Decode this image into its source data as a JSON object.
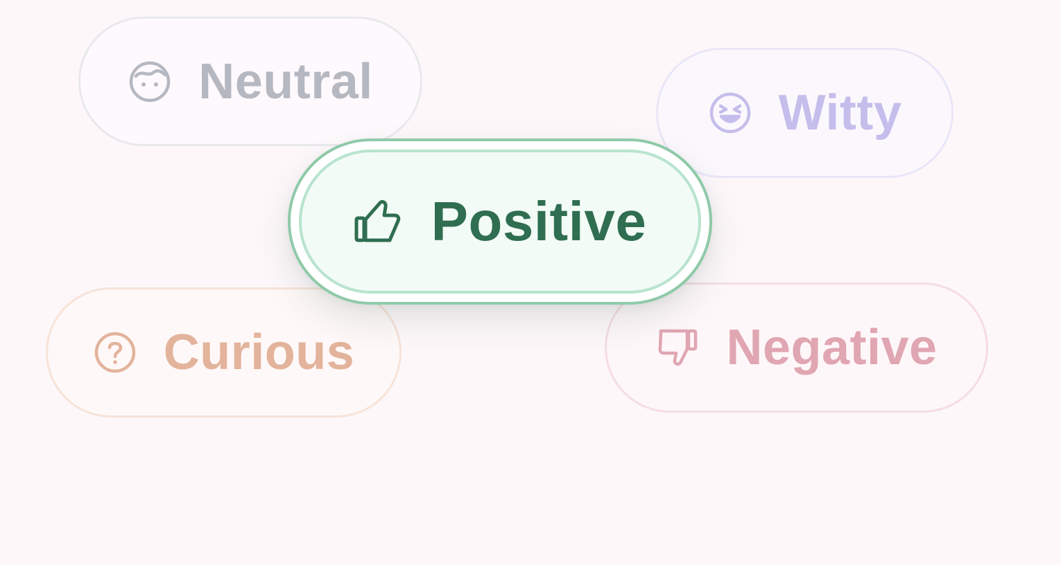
{
  "options": {
    "neutral": {
      "label": "Neutral",
      "icon": "neutral-face-icon",
      "color": "#b6b8c1"
    },
    "witty": {
      "label": "Witty",
      "icon": "laughing-face-icon",
      "color": "#c5bdeb"
    },
    "positive": {
      "label": "Positive",
      "icon": "thumbs-up-icon",
      "color": "#2f6e50",
      "selected": true
    },
    "curious": {
      "label": "Curious",
      "icon": "question-circle-icon",
      "color": "#e3b39b"
    },
    "negative": {
      "label": "Negative",
      "icon": "thumbs-down-icon",
      "color": "#e0a6b2"
    }
  }
}
